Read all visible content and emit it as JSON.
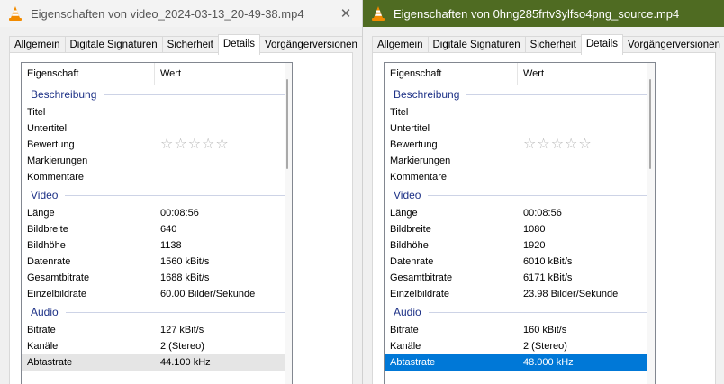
{
  "left": {
    "title": "Eigenschaften von video_2024-03-13_20-49-38.mp4",
    "close": "✕",
    "tabs": [
      "Allgemein",
      "Digitale Signaturen",
      "Sicherheit",
      "Details",
      "Vorgängerversionen"
    ],
    "header": {
      "prop": "Eigenschaft",
      "val": "Wert"
    },
    "groups": {
      "desc": "Beschreibung",
      "video": "Video",
      "audio": "Audio"
    },
    "desc_rows": [
      "Titel",
      "Untertitel",
      "Bewertung",
      "Markierungen",
      "Kommentare"
    ],
    "rating_stars": "☆☆☆☆☆",
    "video_rows": [
      {
        "k": "Länge",
        "v": "00:08:56"
      },
      {
        "k": "Bildbreite",
        "v": "640"
      },
      {
        "k": "Bildhöhe",
        "v": "1138"
      },
      {
        "k": "Datenrate",
        "v": "1560 kBit/s"
      },
      {
        "k": "Gesamtbitrate",
        "v": "1688 kBit/s"
      },
      {
        "k": "Einzelbildrate",
        "v": "60.00 Bilder/Sekunde"
      }
    ],
    "audio_rows": [
      {
        "k": "Bitrate",
        "v": "127 kBit/s"
      },
      {
        "k": "Kanäle",
        "v": "2 (Stereo)"
      },
      {
        "k": "Abtastrate",
        "v": "44.100 kHz"
      }
    ]
  },
  "right": {
    "title": "Eigenschaften von 0hng285frtv3ylfso4png_source.mp4",
    "close": "✕",
    "tabs": [
      "Allgemein",
      "Digitale Signaturen",
      "Sicherheit",
      "Details",
      "Vorgängerversionen"
    ],
    "header": {
      "prop": "Eigenschaft",
      "val": "Wert"
    },
    "groups": {
      "desc": "Beschreibung",
      "video": "Video",
      "audio": "Audio"
    },
    "desc_rows": [
      "Titel",
      "Untertitel",
      "Bewertung",
      "Markierungen",
      "Kommentare"
    ],
    "rating_stars": "☆☆☆☆☆",
    "video_rows": [
      {
        "k": "Länge",
        "v": "00:08:56"
      },
      {
        "k": "Bildbreite",
        "v": "1080"
      },
      {
        "k": "Bildhöhe",
        "v": "1920"
      },
      {
        "k": "Datenrate",
        "v": "6010 kBit/s"
      },
      {
        "k": "Gesamtbitrate",
        "v": "6171 kBit/s"
      },
      {
        "k": "Einzelbildrate",
        "v": "23.98 Bilder/Sekunde"
      }
    ],
    "audio_rows": [
      {
        "k": "Bitrate",
        "v": "160 kBit/s"
      },
      {
        "k": "Kanäle",
        "v": "2 (Stereo)"
      },
      {
        "k": "Abtastrate",
        "v": "48.000 kHz"
      }
    ]
  },
  "colors": {
    "active_titlebar": "#4f6b22",
    "group_heading": "#1e3287",
    "selection_blue": "#0078d7",
    "selection_grey": "#e5e5e5"
  },
  "icons": {
    "app": "vlc-cone-icon",
    "close": "close-icon",
    "rating": "star-icon"
  }
}
